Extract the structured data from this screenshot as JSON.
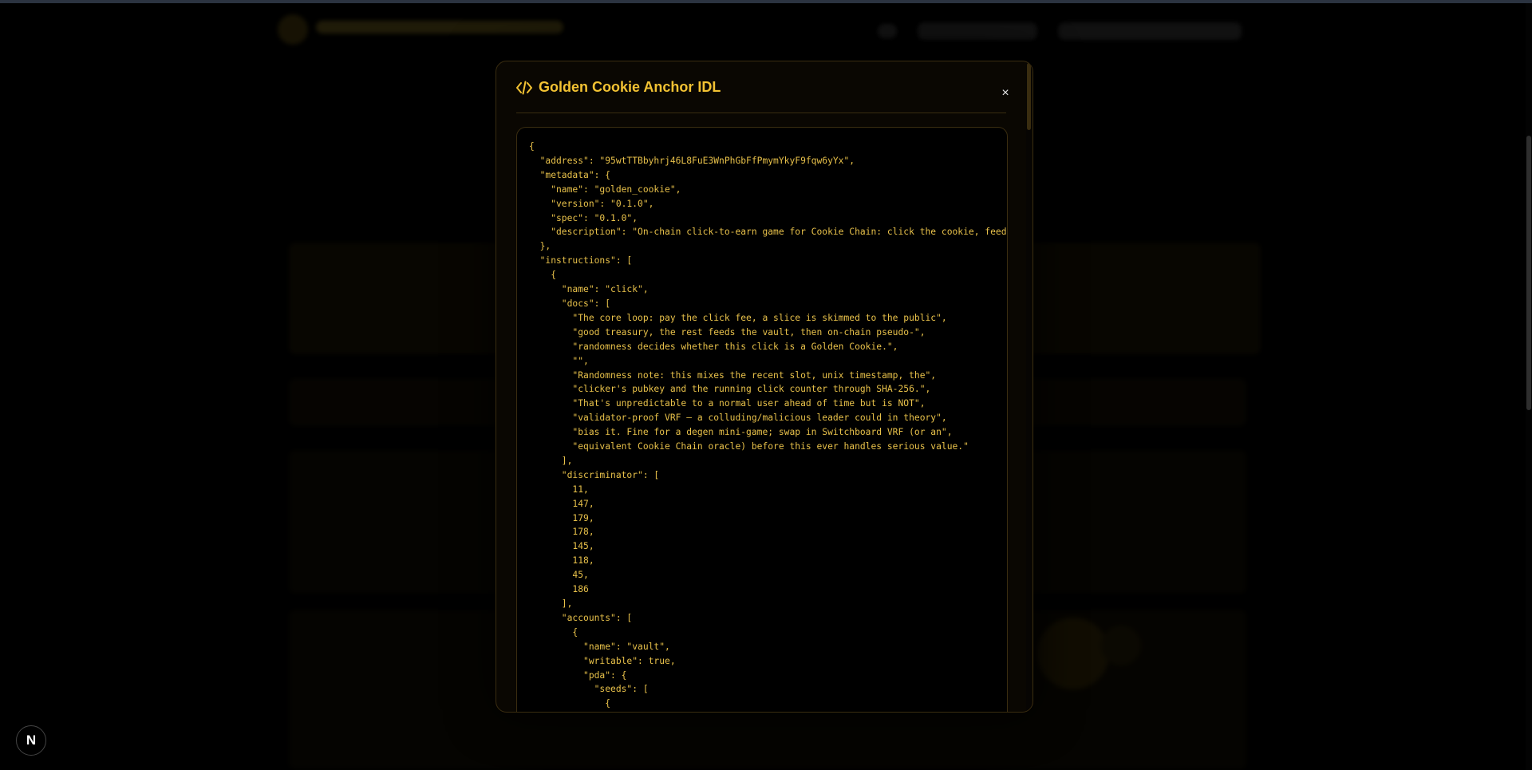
{
  "modal": {
    "title": "Golden Cookie Anchor IDL",
    "close_label": "×",
    "icon": "code-icon"
  },
  "idl_json": "{\n  \"address\": \"95wtTTBbyhrj46L8FuE3WnPhGbFfPmymYkyF9fqw6yYx\",\n  \"metadata\": {\n    \"name\": \"golden_cookie\",\n    \"version\": \"0.1.0\",\n    \"spec\": \"0.1.0\",\n    \"description\": \"On-chain click-to-earn game for Cookie Chain: click the cookie, feed th\n  },\n  \"instructions\": [\n    {\n      \"name\": \"click\",\n      \"docs\": [\n        \"The core loop: pay the click fee, a slice is skimmed to the public\",\n        \"good treasury, the rest feeds the vault, then on-chain pseudo-\",\n        \"randomness decides whether this click is a Golden Cookie.\",\n        \"\",\n        \"Randomness note: this mixes the recent slot, unix timestamp, the\",\n        \"clicker's pubkey and the running click counter through SHA-256.\",\n        \"That's unpredictable to a normal user ahead of time but is NOT\",\n        \"validator-proof VRF — a colluding/malicious leader could in theory\",\n        \"bias it. Fine for a degen mini-game; swap in Switchboard VRF (or an\",\n        \"equivalent Cookie Chain oracle) before this ever handles serious value.\"\n      ],\n      \"discriminator\": [\n        11,\n        147,\n        179,\n        178,\n        145,\n        118,\n        45,\n        186\n      ],\n      \"accounts\": [\n        {\n          \"name\": \"vault\",\n          \"writable\": true,\n          \"pda\": {\n            \"seeds\": [\n              {",
  "badge": {
    "letter": "N"
  },
  "colors": {
    "accent": "#f2c233",
    "code_text": "#e8c14a",
    "border": "#3a2d10",
    "background": "#000000"
  }
}
